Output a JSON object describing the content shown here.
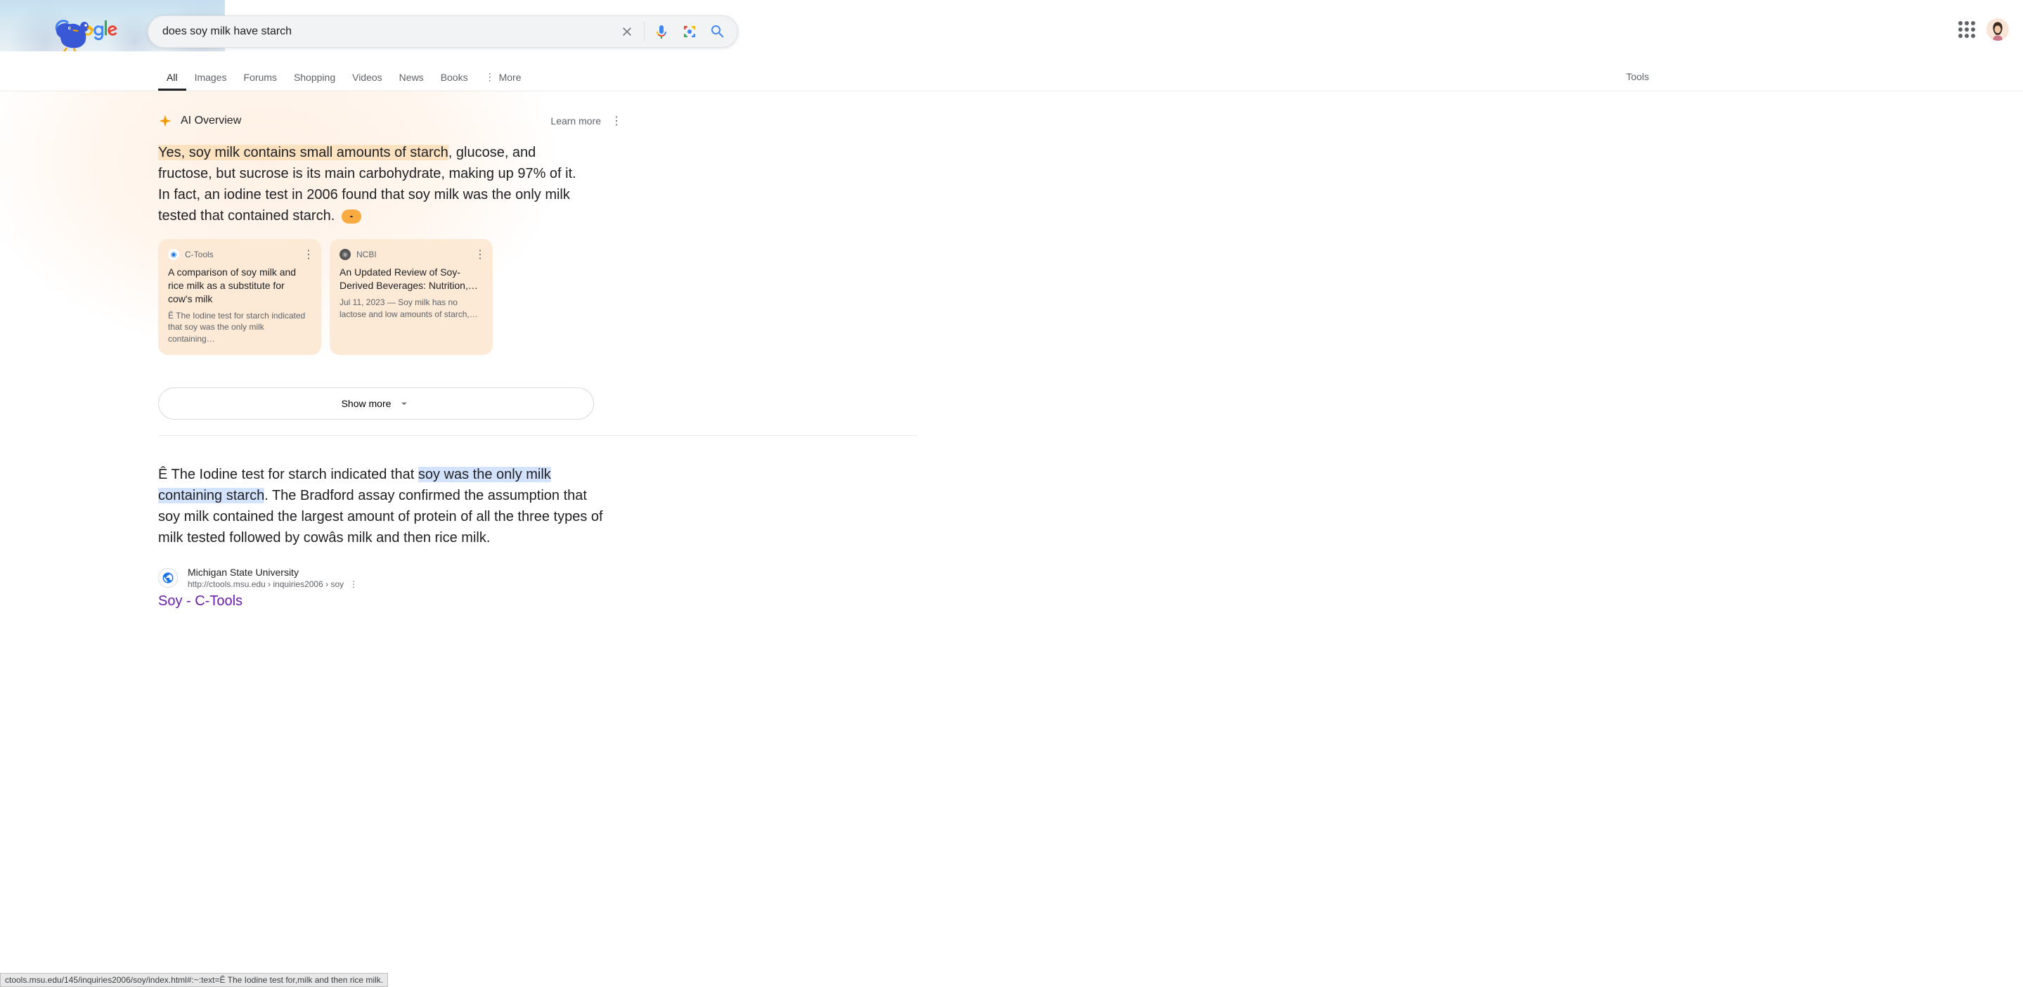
{
  "search": {
    "query": "does soy milk have starch"
  },
  "tabs": {
    "all": "All",
    "images": "Images",
    "forums": "Forums",
    "shopping": "Shopping",
    "videos": "Videos",
    "news": "News",
    "books": "Books",
    "more": "More",
    "tools": "Tools"
  },
  "ai": {
    "title": "AI Overview",
    "learn_more": "Learn more",
    "highlighted": "Yes, soy milk contains small amounts of starch",
    "rest": ", glucose, and fructose, but sucrose is its main carbohydrate, making up 97% of it. In fact, an iodine test in 2006 found that soy milk was the only milk tested that contained starch.",
    "cards": [
      {
        "source": "C-Tools",
        "title": "A comparison of soy milk and rice milk as a substitute for cow's milk",
        "snippet": "Ê The Iodine test for starch indicated that soy was the only milk containing…"
      },
      {
        "source": "NCBI",
        "title": "An Updated Review of Soy-Derived Beverages: Nutrition,…",
        "snippet": "Jul 11, 2023 — Soy milk has no lactose and low amounts of starch,…"
      }
    ],
    "show_more": "Show more"
  },
  "result": {
    "pre": "Ê The Iodine test for starch indicated that ",
    "highlight": "soy was the only milk containing starch",
    "post": ". The Bradford assay confirmed the assumption that soy milk contained the largest amount of protein of all the three types of milk tested followed by cowâs milk and then rice milk.",
    "site_name": "Michigan State University",
    "url_display": "http://ctools.msu.edu › inquiries2006 › soy",
    "title": "Soy - C-Tools"
  },
  "status_url": "ctools.msu.edu/145/inquiries2006/soy/index.html#:~:text=Ê The Iodine test for,milk and then rice milk."
}
